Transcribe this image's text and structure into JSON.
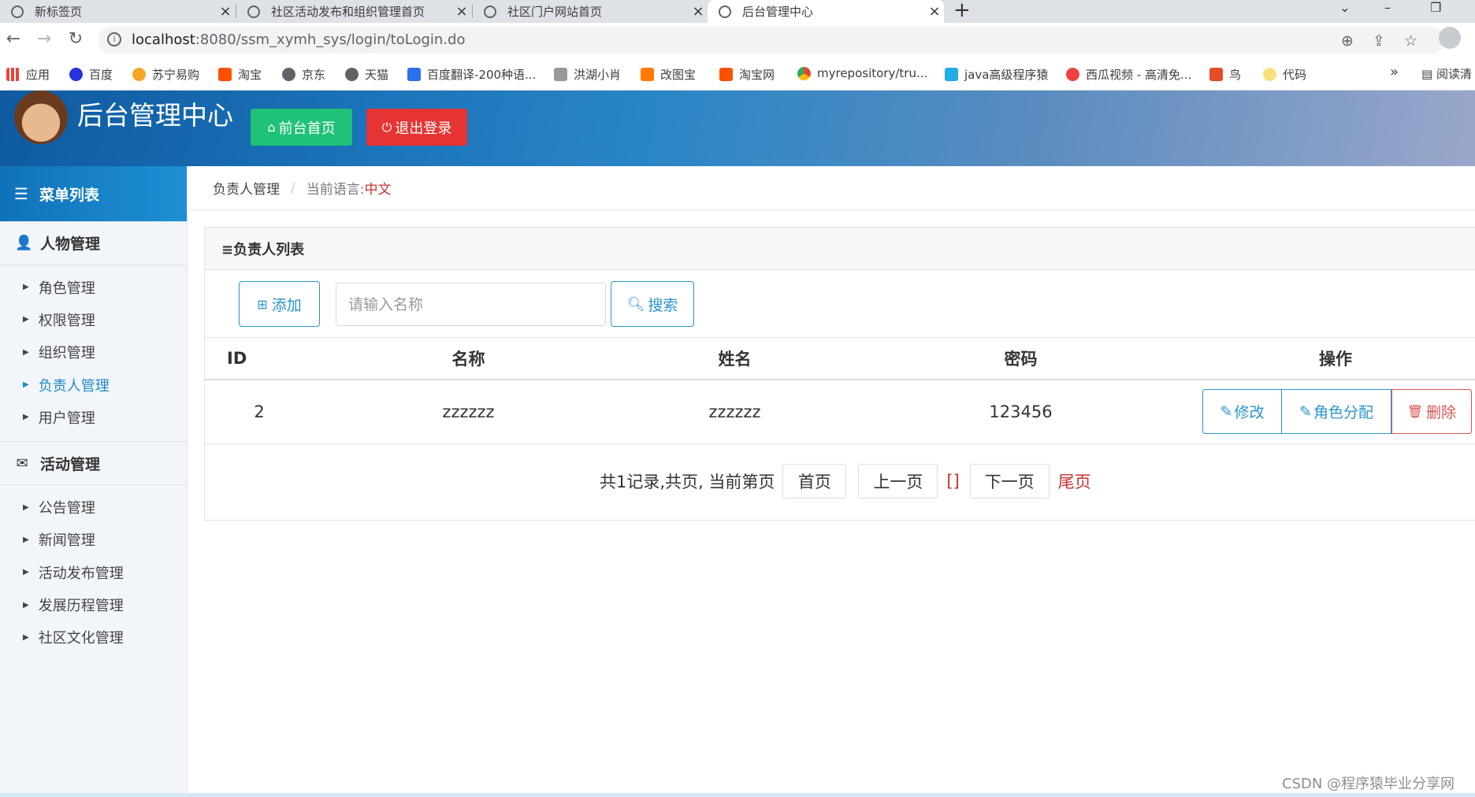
{
  "browser": {
    "tabs": [
      {
        "label": "新标签页"
      },
      {
        "label": "社区活动发布和组织管理首页"
      },
      {
        "label": "社区门户网站首页"
      },
      {
        "label": "后台管理中心"
      }
    ],
    "tab_close": "×",
    "new_tab": "+",
    "url_host": "localhost",
    "url_rest": ":8080/ssm_xymh_sys/login/toLogin.do",
    "bookmarks": [
      {
        "label": "应用",
        "color": "#e8453c"
      },
      {
        "label": "百度",
        "color": "#2932e1"
      },
      {
        "label": "苏宁易购",
        "color": "#f5a623"
      },
      {
        "label": "淘宝",
        "color": "#ff5000"
      },
      {
        "label": "京东",
        "color": "#5f6368"
      },
      {
        "label": "天猫",
        "color": "#5f6368"
      },
      {
        "label": "百度翻译-200种语...",
        "color": "#2c6ff0"
      },
      {
        "label": "洪湖小肖",
        "color": "#777777"
      },
      {
        "label": "改图宝",
        "color": "#ff7a00"
      },
      {
        "label": "淘宝网",
        "color": "#ff5000"
      },
      {
        "label": "myrepository/tru...",
        "color": "#4caf50"
      },
      {
        "label": "java高级程序猿",
        "color": "#23ade5"
      },
      {
        "label": "西瓜视频 - 高清免...",
        "color": "#f04142"
      },
      {
        "label": "鸟",
        "color": "#e44d26"
      },
      {
        "label": "代码",
        "color": "#f7e27a"
      }
    ],
    "bookmarks_more": "»",
    "reading_list": "阅读清"
  },
  "header": {
    "title": "后台管理中心",
    "front_button": "前台首页",
    "logout_button": "退出登录"
  },
  "sidebar": {
    "menu_title": "菜单列表",
    "groups": [
      {
        "title": "人物管理",
        "items": [
          "角色管理",
          "权限管理",
          "组织管理",
          "负责人管理",
          "用户管理"
        ]
      },
      {
        "title": "活动管理",
        "items": [
          "公告管理",
          "新闻管理",
          "活动发布管理",
          "发展历程管理",
          "社区文化管理"
        ]
      }
    ],
    "active_item": "负责人管理"
  },
  "breadcrumb": {
    "section": "负责人管理",
    "lang_label": "当前语言:",
    "lang_value": "中文"
  },
  "panel": {
    "title": "≡负责人列表",
    "add_button": "添加",
    "search_placeholder": "请输入名称",
    "search_button": "搜索",
    "columns": [
      "ID",
      "名称",
      "姓名",
      "密码",
      "操作"
    ],
    "rows": [
      {
        "id": "2",
        "name": "zzzzzz",
        "realname": "zzzzzz",
        "password": "123456"
      }
    ],
    "row_actions": {
      "edit": "修改",
      "assign": "角色分配",
      "delete": "删除"
    }
  },
  "pager": {
    "summary": "共1记录,共页, 当前第页",
    "first": "首页",
    "prev": "上一页",
    "current": "[]",
    "next": "下一页",
    "last": "尾页"
  },
  "watermark": "CSDN @程序猿毕业分享网"
}
